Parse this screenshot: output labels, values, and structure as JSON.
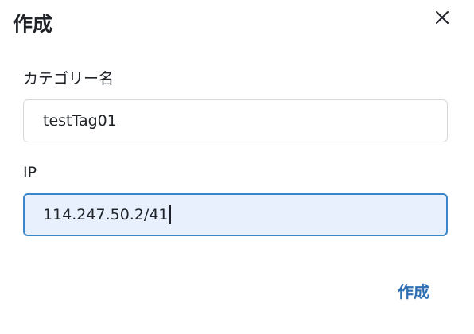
{
  "dialog": {
    "title": "作成",
    "close_icon": "close-icon"
  },
  "fields": {
    "category": {
      "label": "カテゴリー名",
      "value": "testTag01"
    },
    "ip": {
      "label": "IP",
      "value": "114.247.50.2/41"
    }
  },
  "actions": {
    "submit_label": "作成"
  },
  "colors": {
    "accent": "#2f6fb3",
    "focus_border": "#3a86c8",
    "focus_background": "#e8f0fd"
  }
}
